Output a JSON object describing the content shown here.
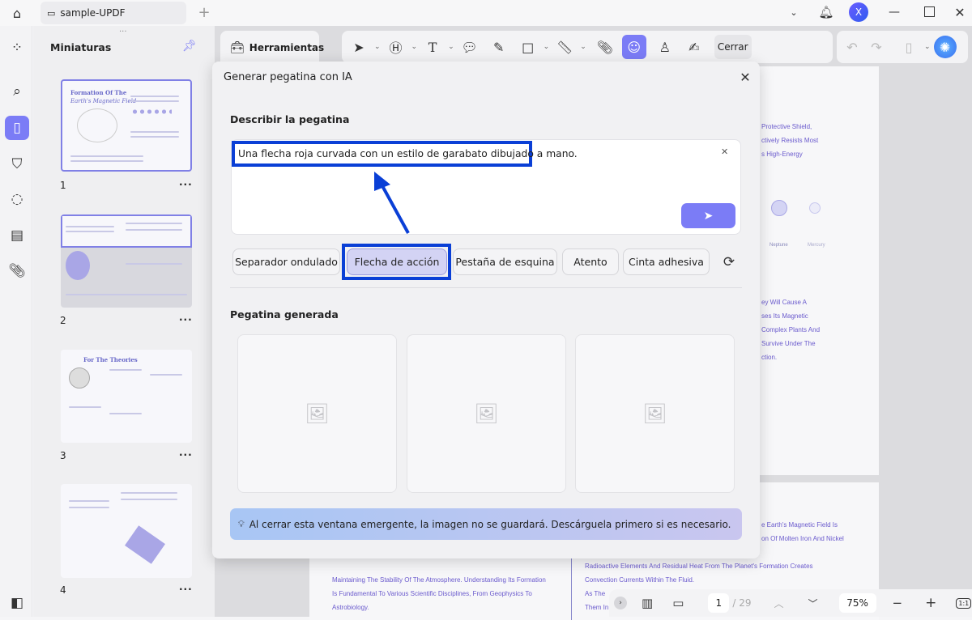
{
  "app": {
    "tab_title": "sample-UPDF",
    "avatar_letter": "X"
  },
  "sidebar": {
    "title": "Miniaturas",
    "pages": [
      {
        "num": "1",
        "heading": "Formation Of The",
        "subheading": "Earth's Magnetic Field"
      },
      {
        "num": "2"
      },
      {
        "num": "3",
        "heading": "For The Theories"
      },
      {
        "num": "4"
      }
    ],
    "more": "···"
  },
  "toolbar": {
    "tools_tab": "Herramientas",
    "close_label": "Cerrar"
  },
  "dialog": {
    "title": "Generar pegatina con IA",
    "describe_label": "Describir la pegatina",
    "prompt_value": "Una flecha roja curvada con un estilo de garabato dibujado a mano.",
    "suggestions": [
      {
        "label": "Separador ondulado",
        "selected": false
      },
      {
        "label": "Flecha de acción",
        "selected": true
      },
      {
        "label": "Pestaña de esquina",
        "selected": false
      },
      {
        "label": "Atento",
        "selected": false
      },
      {
        "label": "Cinta adhesiva",
        "selected": false
      }
    ],
    "generated_label": "Pegatina generada",
    "info_text": "Al cerrar esta ventana emergente, la imagen no se guardará. Descárguela primero si es necesario.",
    "accent": "#7b7cf6",
    "highlight": "#0a3fd6"
  },
  "document": {
    "right_lines_top": [
      "Protective Shield,",
      "ctively Resists Most",
      "s High-Energy"
    ],
    "planets": [
      "Neptune",
      "Mercury"
    ],
    "right_lines_mid": [
      "ey Will Cause A",
      "ses Its Magnetic",
      "Complex Plants And",
      "Survive Under The",
      "ction."
    ],
    "right_lines_bottom": [
      "e Earth's Magnetic Field Is",
      "on Of Molten Iron And Nickel",
      "Radioactive Elements And Residual Heat From The Planet's Formation Creates",
      "Convection Currents Within The Fluid.",
      "As The",
      "Them In"
    ],
    "left_lines_bottom": [
      "Maintaining The Stability Of The Atmosphere. Understanding Its Formation",
      "Is Fundamental To Various Scientific Disciplines, From Geophysics To",
      "Astrobiology."
    ]
  },
  "nav": {
    "page_current": "1",
    "page_total": "/ 29",
    "zoom": "75%",
    "fit_label": "1:1"
  }
}
